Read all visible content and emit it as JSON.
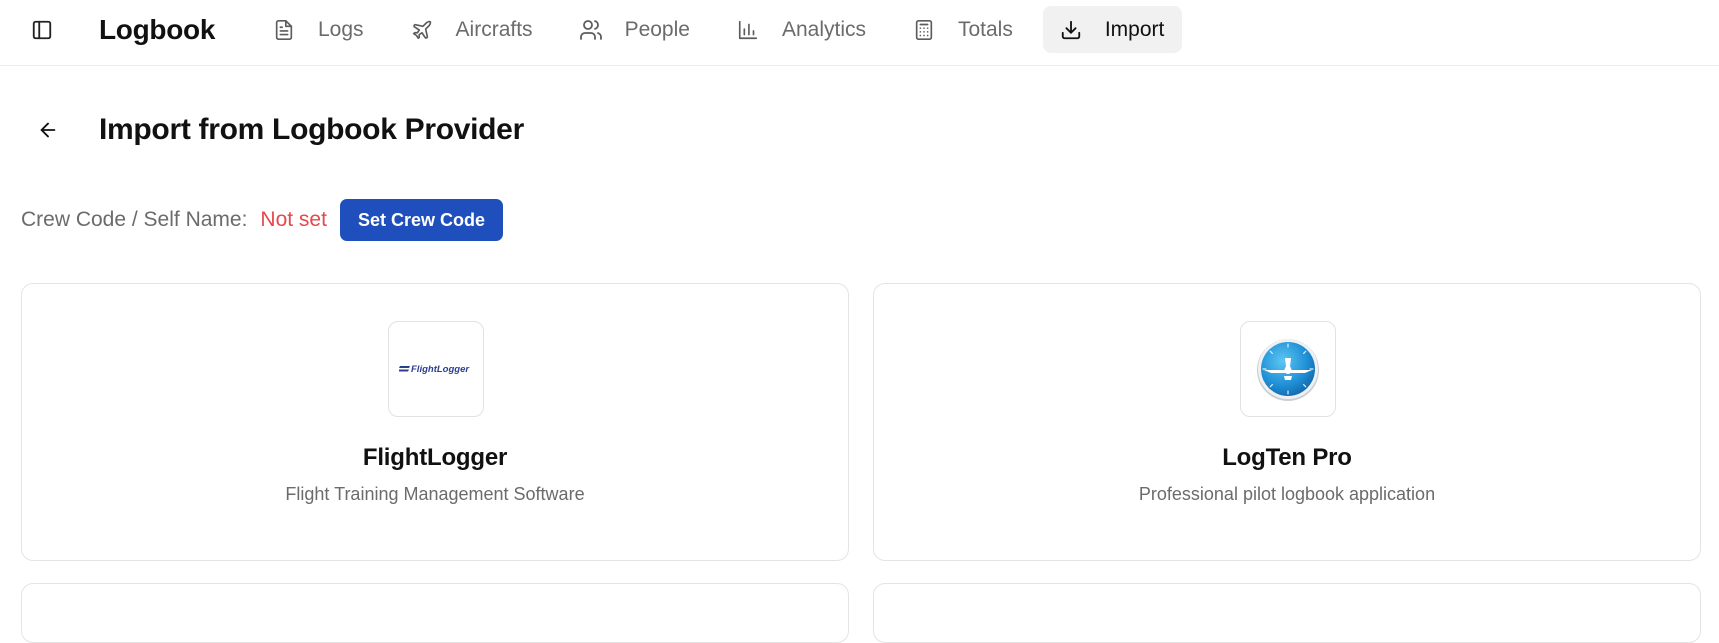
{
  "app": {
    "title": "Logbook"
  },
  "nav": {
    "items": [
      {
        "label": "Logs",
        "icon": "file-text-icon"
      },
      {
        "label": "Aircrafts",
        "icon": "plane-icon"
      },
      {
        "label": "People",
        "icon": "users-icon"
      },
      {
        "label": "Analytics",
        "icon": "bar-chart-icon"
      },
      {
        "label": "Totals",
        "icon": "calculator-icon"
      },
      {
        "label": "Import",
        "icon": "download-icon",
        "active": true
      }
    ]
  },
  "page": {
    "title": "Import from Logbook Provider"
  },
  "crew": {
    "label": "Crew Code / Self Name:",
    "value": "Not set",
    "button_label": "Set Crew Code"
  },
  "providers": [
    {
      "name": "FlightLogger",
      "description": "Flight Training Management Software",
      "logo_text": "FlightLogger"
    },
    {
      "name": "LogTen Pro",
      "description": "Professional pilot logbook application"
    }
  ],
  "colors": {
    "accent": "#1f4fbd",
    "warning_text": "#e5484d",
    "muted_text": "#6b6b6b",
    "active_tab_bg": "#f1f1f2"
  }
}
